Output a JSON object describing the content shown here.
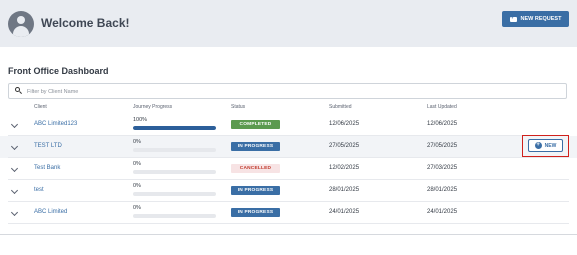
{
  "header": {
    "welcome": "Welcome Back!",
    "new_request_label": "NEW REQUEST"
  },
  "dashboard": {
    "title": "Front Office Dashboard",
    "filter_placeholder": "Filter by Client Name"
  },
  "columns": {
    "client": "Client",
    "progress": "Journey Progress",
    "status": "Status",
    "submitted": "Submitted",
    "updated": "Last Updated"
  },
  "rows": [
    {
      "client": "ABC Limited123",
      "progress_label": "100%",
      "progress": 1.0,
      "status": "COMPLETED",
      "submitted": "12/06/2025",
      "updated": "12/06/2025"
    },
    {
      "client": "TEST LTD",
      "progress_label": "0%",
      "progress": 0.0,
      "status": "IN PROGRESS",
      "submitted": "27/05/2025",
      "updated": "27/05/2025"
    },
    {
      "client": "Test Bank",
      "progress_label": "0%",
      "progress": 0.0,
      "status": "CANCELLED",
      "submitted": "12/02/2025",
      "updated": "27/03/2025"
    },
    {
      "client": "test",
      "progress_label": "0%",
      "progress": 0.0,
      "status": "IN PROGRESS",
      "submitted": "28/01/2025",
      "updated": "28/01/2025"
    },
    {
      "client": "ABC Limited",
      "progress_label": "0%",
      "progress": 0.0,
      "status": "IN PROGRESS",
      "submitted": "24/01/2025",
      "updated": "24/01/2025"
    }
  ],
  "row_action": {
    "new_label": "NEW"
  },
  "colors": {
    "accent": "#3a6ea5",
    "completed": "#5b9a4f",
    "cancelled_text": "#c0392b",
    "highlight": "#d0211c"
  },
  "icons": {
    "avatar": "user-avatar-icon",
    "new_request": "folder-plus-icon",
    "filter": "search-icon",
    "expand": "chevron-down-icon",
    "new": "plus-circle-icon"
  }
}
